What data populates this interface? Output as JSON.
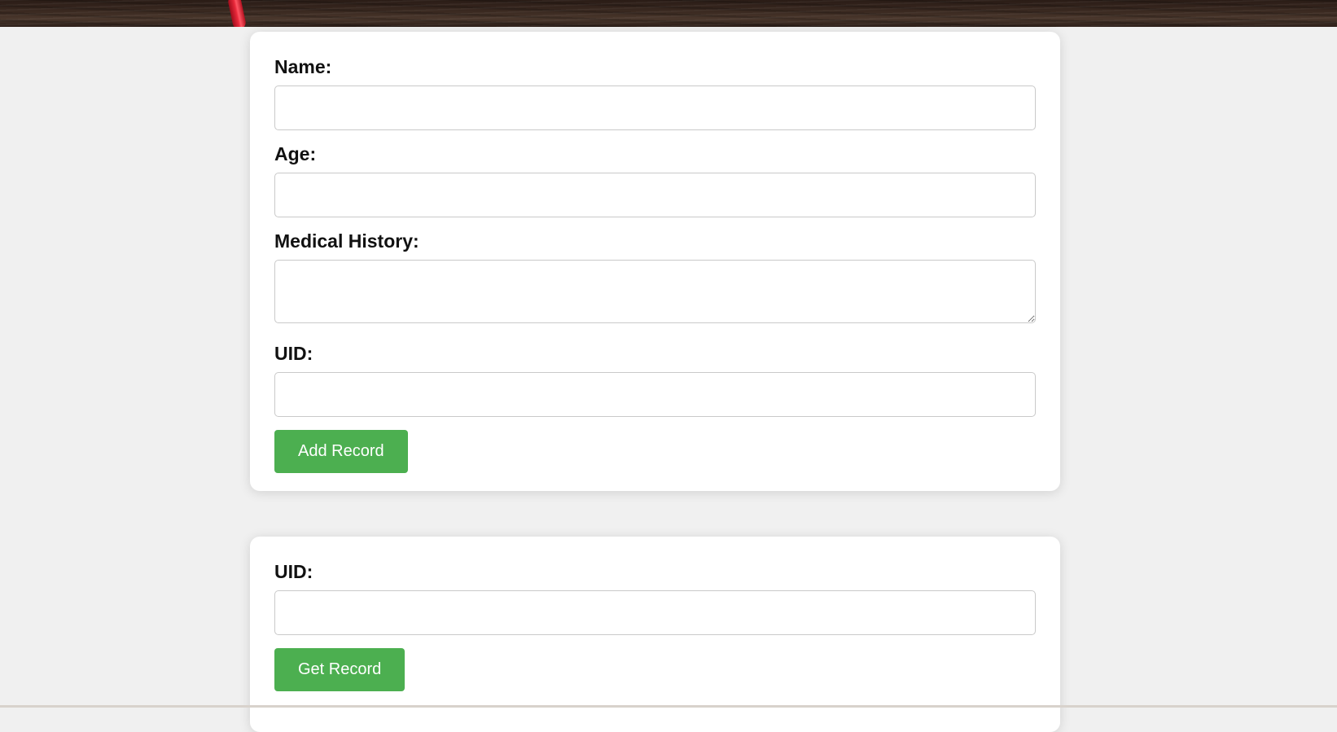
{
  "add_form": {
    "name_label": "Name:",
    "age_label": "Age:",
    "history_label": "Medical History:",
    "uid_label": "UID:",
    "name_value": "",
    "age_value": "",
    "history_value": "",
    "uid_value": "",
    "submit_label": "Add Record"
  },
  "get_form": {
    "uid_label": "UID:",
    "uid_value": "",
    "submit_label": "Get Record"
  },
  "colors": {
    "button": "#4caf50",
    "page_background": "#f0f0f0",
    "card": "#ffffff"
  }
}
